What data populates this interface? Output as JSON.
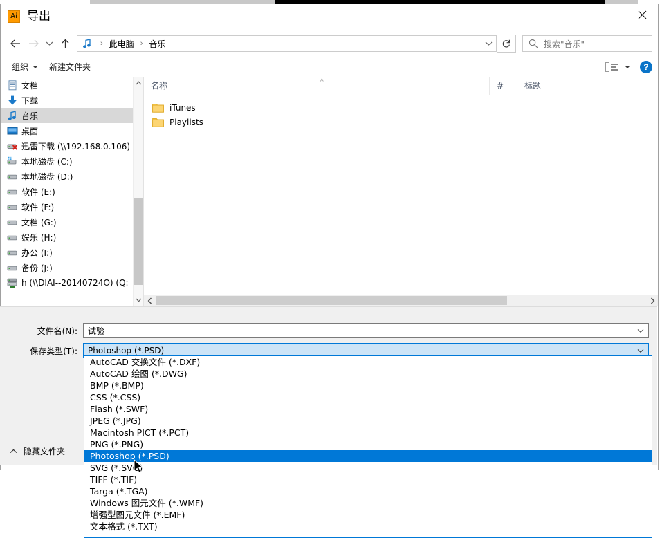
{
  "window": {
    "title": "导出",
    "app_icon": "Ai",
    "close_label": "关闭"
  },
  "nav": {
    "back": "后退",
    "forward": "前进",
    "recent": "最近使用的位置",
    "up": "上移一级",
    "refresh": "刷新",
    "breadcrumb": [
      "此电脑",
      "音乐"
    ],
    "breadcrumb_icon": "music-note-icon"
  },
  "search": {
    "placeholder": "搜索\"音乐\"",
    "icon": "search-icon"
  },
  "toolbar": {
    "organize": "组织",
    "new_folder": "新建文件夹",
    "view_icon": "view-list-icon",
    "help": "?"
  },
  "sidebar": {
    "items": [
      {
        "label": "文档",
        "icon": "document-icon",
        "selected": false
      },
      {
        "label": "下载",
        "icon": "download-icon",
        "selected": false
      },
      {
        "label": "音乐",
        "icon": "music-note-icon",
        "selected": true
      },
      {
        "label": "桌面",
        "icon": "desktop-icon",
        "selected": false
      },
      {
        "label": "迅雷下载 (\\\\192.168.0.106)",
        "icon": "network-drive-offline-icon",
        "selected": false
      },
      {
        "label": "本地磁盘 (C:)",
        "icon": "system-drive-icon",
        "selected": false
      },
      {
        "label": "本地磁盘 (D:)",
        "icon": "drive-icon",
        "selected": false
      },
      {
        "label": "软件 (E:)",
        "icon": "drive-icon",
        "selected": false
      },
      {
        "label": "软件 (F:)",
        "icon": "drive-icon",
        "selected": false
      },
      {
        "label": "文档 (G:)",
        "icon": "drive-icon",
        "selected": false
      },
      {
        "label": "娱乐 (H:)",
        "icon": "drive-icon",
        "selected": false
      },
      {
        "label": "办公 (I:)",
        "icon": "drive-icon",
        "selected": false
      },
      {
        "label": "备份 (J:)",
        "icon": "drive-icon",
        "selected": false
      },
      {
        "label": "h (\\\\DIAI--20140724O) (Q:",
        "icon": "network-drive-icon",
        "selected": false
      }
    ]
  },
  "filelist": {
    "columns": [
      {
        "label": "名称",
        "key": "name"
      },
      {
        "label": "#",
        "key": "num"
      },
      {
        "label": "标题",
        "key": "title"
      }
    ],
    "sort_indicator": "^",
    "rows": [
      {
        "name": "iTunes",
        "icon": "folder-icon"
      },
      {
        "name": "Playlists",
        "icon": "folder-icon"
      }
    ]
  },
  "form": {
    "filename_label": "文件名(N):",
    "filename_value": "试验",
    "filetype_label": "保存类型(T):",
    "filetype_value": "Photoshop (*.PSD)",
    "hide_folders": "隐藏文件夹"
  },
  "dropdown": {
    "selected": "Photoshop (*.PSD)",
    "options": [
      "AutoCAD 交换文件 (*.DXF)",
      "AutoCAD 绘图 (*.DWG)",
      "BMP (*.BMP)",
      "CSS (*.CSS)",
      "Flash (*.SWF)",
      "JPEG (*.JPG)",
      "Macintosh PICT (*.PCT)",
      "PNG (*.PNG)",
      "Photoshop (*.PSD)",
      "SVG (*.SVG)",
      "TIFF (*.TIF)",
      "Targa (*.TGA)",
      "Windows 图元文件 (*.WMF)",
      "增强型图元文件 (*.EMF)",
      "文本格式 (*.TXT)"
    ]
  },
  "colors": {
    "accent": "#0078d7",
    "selection_bg": "#cce4f7",
    "sidebar_selected": "#d8d8d8",
    "app_icon": "#ff9a00",
    "panel_bg": "#f0f0f0"
  }
}
